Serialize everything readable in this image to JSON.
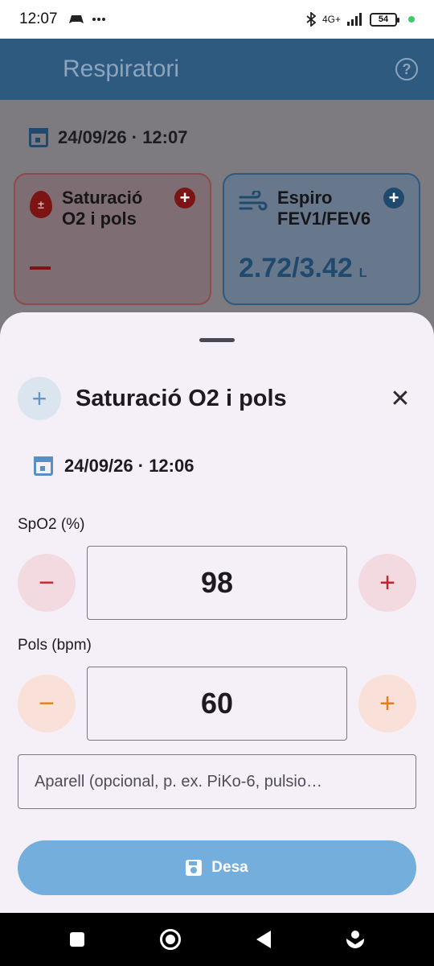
{
  "status_bar": {
    "time": "12:07",
    "network": "4G+",
    "battery": "54"
  },
  "app_bar": {
    "title": "Respiratori",
    "help_icon": "help-circle-icon"
  },
  "background": {
    "datetime": "24/09/26 · 12:07",
    "cards": [
      {
        "title_line1": "Saturació",
        "title_line2": "O2 i pols",
        "value": "",
        "accent": "#7d1414"
      },
      {
        "title_line1": "Espiro",
        "title_line2": "FEV1/FEV6",
        "value": "2.72/3.42",
        "unit": "L",
        "accent": "#1f4a6e"
      }
    ]
  },
  "sheet": {
    "title": "Saturació O2 i pols",
    "datetime": "24/09/26 · 12:06",
    "spo2": {
      "label": "SpO2 (%)",
      "value": "98",
      "minus": "−",
      "plus": "+"
    },
    "pulse": {
      "label": "Pols (bpm)",
      "value": "60",
      "minus": "−",
      "plus": "+"
    },
    "device": {
      "placeholder": "Aparell (opcional, p. ex. PiKo-6, pulsio…"
    },
    "save_label": "Desa"
  },
  "colors": {
    "primary": "#2e5a80",
    "save_button": "#73aedc",
    "spo2_accent": "#c0262c",
    "pulse_accent": "#e67e16"
  }
}
